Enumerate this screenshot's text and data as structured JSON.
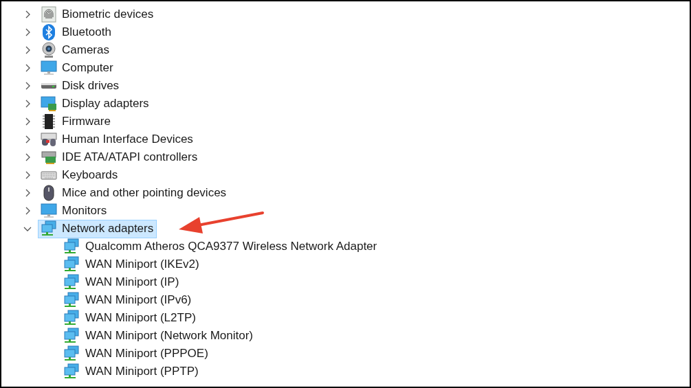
{
  "device_tree": [
    {
      "label": "Biometric devices",
      "expanded": false,
      "selected": false
    },
    {
      "label": "Bluetooth",
      "expanded": false,
      "selected": false
    },
    {
      "label": "Cameras",
      "expanded": false,
      "selected": false
    },
    {
      "label": "Computer",
      "expanded": false,
      "selected": false
    },
    {
      "label": "Disk drives",
      "expanded": false,
      "selected": false
    },
    {
      "label": "Display adapters",
      "expanded": false,
      "selected": false
    },
    {
      "label": "Firmware",
      "expanded": false,
      "selected": false
    },
    {
      "label": "Human Interface Devices",
      "expanded": false,
      "selected": false
    },
    {
      "label": "IDE ATA/ATAPI controllers",
      "expanded": false,
      "selected": false
    },
    {
      "label": "Keyboards",
      "expanded": false,
      "selected": false
    },
    {
      "label": "Mice and other pointing devices",
      "expanded": false,
      "selected": false
    },
    {
      "label": "Monitors",
      "expanded": false,
      "selected": false
    },
    {
      "label": "Network adapters",
      "expanded": true,
      "selected": true,
      "children": [
        {
          "label": "Qualcomm Atheros QCA9377 Wireless Network Adapter",
          "selected": false
        },
        {
          "label": "WAN Miniport (IKEv2)",
          "selected": false
        },
        {
          "label": "WAN Miniport (IP)",
          "selected": false
        },
        {
          "label": "WAN Miniport (IPv6)",
          "selected": false
        },
        {
          "label": "WAN Miniport (L2TP)",
          "selected": false
        },
        {
          "label": "WAN Miniport (Network Monitor)",
          "selected": false
        },
        {
          "label": "WAN Miniport (PPPOE)",
          "selected": false
        },
        {
          "label": "WAN Miniport (PPTP)",
          "selected": false
        }
      ]
    }
  ]
}
